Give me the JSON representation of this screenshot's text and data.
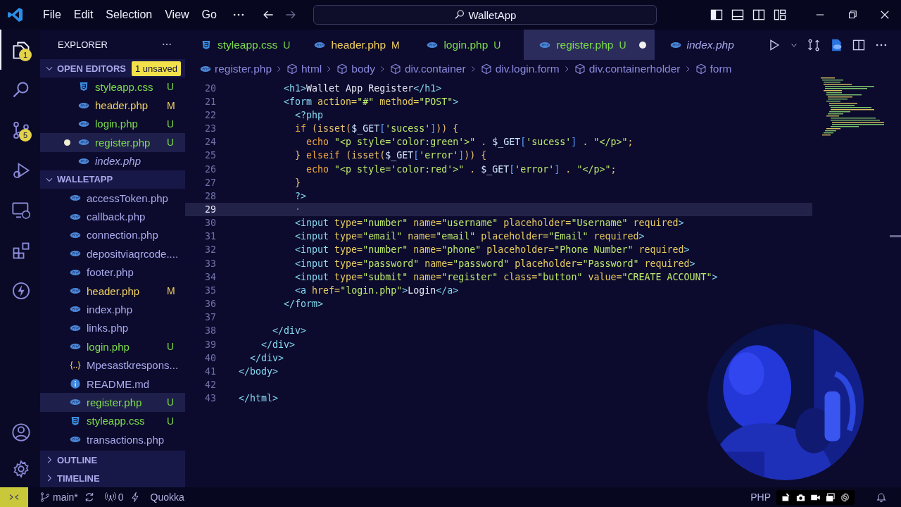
{
  "title_bar": {
    "menu": [
      "File",
      "Edit",
      "Selection",
      "View",
      "Go"
    ],
    "search": {
      "value": "WalletApp"
    }
  },
  "activity_bar": {
    "items": [
      {
        "kind": "files",
        "selected": true,
        "badge": "1"
      },
      {
        "kind": "search",
        "selected": false
      },
      {
        "kind": "source-control",
        "selected": false,
        "badge": "5"
      },
      {
        "kind": "run",
        "selected": false
      },
      {
        "kind": "remote",
        "selected": false
      },
      {
        "kind": "extensions",
        "selected": false
      },
      {
        "kind": "bolt",
        "selected": false
      }
    ],
    "bottom": [
      {
        "kind": "account"
      },
      {
        "kind": "settings"
      }
    ]
  },
  "explorer": {
    "title": "EXPLORER",
    "open_editors": {
      "label": "OPEN EDITORS",
      "expanded": true,
      "badge": "1 unsaved",
      "items": [
        {
          "name": "styleapp.css",
          "kind": "css",
          "status": "U",
          "selected": false,
          "unsaved": false,
          "preview": false
        },
        {
          "name": "header.php",
          "kind": "php",
          "status": "M",
          "selected": false,
          "unsaved": false,
          "preview": false
        },
        {
          "name": "login.php",
          "kind": "php",
          "status": "U",
          "selected": false,
          "unsaved": false,
          "preview": false
        },
        {
          "name": "register.php",
          "kind": "php",
          "status": "U",
          "selected": true,
          "unsaved": true,
          "preview": false
        },
        {
          "name": "index.php",
          "kind": "php",
          "selected": false,
          "unsaved": false,
          "preview": true
        }
      ]
    },
    "folder": {
      "label": "WALLETAPP",
      "expanded": true,
      "items": [
        {
          "name": "accessToken.php",
          "kind": "php",
          "selected": false
        },
        {
          "name": "callback.php",
          "kind": "php",
          "selected": false
        },
        {
          "name": "connection.php",
          "kind": "php",
          "selected": false
        },
        {
          "name": "depositviaqrcode....",
          "kind": "php",
          "selected": false
        },
        {
          "name": "footer.php",
          "kind": "php",
          "selected": false
        },
        {
          "name": "header.php",
          "kind": "php",
          "status": "M",
          "selected": false
        },
        {
          "name": "index.php",
          "kind": "php",
          "selected": false
        },
        {
          "name": "links.php",
          "kind": "php",
          "selected": false
        },
        {
          "name": "login.php",
          "kind": "php",
          "status": "U",
          "selected": false
        },
        {
          "name": "Mpesastkrespons...",
          "kind": "json",
          "selected": false
        },
        {
          "name": "README.md",
          "kind": "info",
          "selected": false
        },
        {
          "name": "register.php",
          "kind": "php",
          "status": "U",
          "selected": true
        },
        {
          "name": "styleapp.css",
          "kind": "css",
          "status": "U",
          "selected": false
        },
        {
          "name": "transactions.php",
          "kind": "php",
          "selected": false
        }
      ]
    },
    "sections": [
      {
        "label": "OUTLINE",
        "expanded": false
      },
      {
        "label": "TIMELINE",
        "expanded": false
      }
    ]
  },
  "tabs": [
    {
      "label": "styleapp.css",
      "kind": "css",
      "status": "U",
      "selected": false,
      "dirty": false,
      "preview": false
    },
    {
      "label": "header.php",
      "kind": "php",
      "status": "M",
      "selected": false,
      "dirty": false,
      "preview": false
    },
    {
      "label": "login.php",
      "kind": "php",
      "status": "U",
      "selected": false,
      "dirty": false,
      "preview": false
    },
    {
      "label": "register.php",
      "kind": "php",
      "status": "U",
      "selected": true,
      "dirty": true,
      "preview": false
    },
    {
      "label": "index.php",
      "kind": "php",
      "selected": false,
      "dirty": false,
      "preview": true
    }
  ],
  "breadcrumbs": [
    {
      "label": "register.php",
      "kind": "php"
    },
    {
      "label": "html",
      "kind": "element"
    },
    {
      "label": "body",
      "kind": "element"
    },
    {
      "label": "div.container",
      "kind": "element"
    },
    {
      "label": "div.login.form",
      "kind": "element"
    },
    {
      "label": "div.containerholder",
      "kind": "element"
    },
    {
      "label": "form",
      "kind": "element"
    }
  ],
  "editor": {
    "lines": [
      {
        "number": "20",
        "current": false,
        "tokens": [
          {
            "kind": "tag",
            "text": "        <h1>"
          },
          {
            "kind": "text",
            "text": "Wallet App Register"
          },
          {
            "kind": "tag",
            "text": "</h1>"
          }
        ]
      },
      {
        "number": "21",
        "current": false,
        "tokens": [
          {
            "kind": "tag",
            "text": "        <form"
          },
          {
            "kind": "attr",
            "text": " action="
          },
          {
            "kind": "str",
            "text": "\"#\""
          },
          {
            "kind": "attr",
            "text": " method="
          },
          {
            "kind": "str",
            "text": "\"POST\""
          },
          {
            "kind": "tag",
            "text": ">"
          }
        ]
      },
      {
        "number": "22",
        "current": false,
        "tokens": [
          {
            "kind": "tag",
            "text": "          <?php"
          }
        ]
      },
      {
        "number": "23",
        "current": false,
        "tokens": [
          {
            "kind": "kw",
            "text": "          if"
          },
          {
            "kind": "plain",
            "text": " (isset("
          },
          {
            "kind": "var",
            "text": "$_GET"
          },
          {
            "kind": "punct",
            "text": "["
          },
          {
            "kind": "str",
            "text": "'sucess'"
          },
          {
            "kind": "punct",
            "text": "]"
          },
          {
            "kind": "plain",
            "text": ")) {"
          }
        ]
      },
      {
        "number": "24",
        "current": false,
        "tokens": [
          {
            "kind": "kw",
            "text": "            echo "
          },
          {
            "kind": "str",
            "text": "\"<p style='color:green'>\""
          },
          {
            "kind": "plain",
            "text": " . "
          },
          {
            "kind": "var",
            "text": "$_GET"
          },
          {
            "kind": "punct",
            "text": "["
          },
          {
            "kind": "str",
            "text": "'sucess'"
          },
          {
            "kind": "punct",
            "text": "]"
          },
          {
            "kind": "plain",
            "text": " . "
          },
          {
            "kind": "str",
            "text": "\"</p>\""
          },
          {
            "kind": "plain",
            "text": ";"
          }
        ]
      },
      {
        "number": "25",
        "current": false,
        "tokens": [
          {
            "kind": "plain",
            "text": "          } "
          },
          {
            "kind": "kw",
            "text": "elseif"
          },
          {
            "kind": "plain",
            "text": " (isset("
          },
          {
            "kind": "var",
            "text": "$_GET"
          },
          {
            "kind": "punct",
            "text": "["
          },
          {
            "kind": "str",
            "text": "'error'"
          },
          {
            "kind": "punct",
            "text": "]"
          },
          {
            "kind": "plain",
            "text": ")) {"
          }
        ]
      },
      {
        "number": "26",
        "current": false,
        "tokens": [
          {
            "kind": "kw",
            "text": "            echo "
          },
          {
            "kind": "str",
            "text": "\"<p style='color:red'>\""
          },
          {
            "kind": "plain",
            "text": " . "
          },
          {
            "kind": "var",
            "text": "$_GET"
          },
          {
            "kind": "punct",
            "text": "["
          },
          {
            "kind": "str",
            "text": "'error'"
          },
          {
            "kind": "punct",
            "text": "]"
          },
          {
            "kind": "plain",
            "text": " . "
          },
          {
            "kind": "str",
            "text": "\"</p>\""
          },
          {
            "kind": "plain",
            "text": ";"
          }
        ]
      },
      {
        "number": "27",
        "current": false,
        "tokens": [
          {
            "kind": "plain",
            "text": "          }"
          }
        ]
      },
      {
        "number": "28",
        "current": false,
        "tokens": [
          {
            "kind": "tag",
            "text": "          ?>"
          }
        ]
      },
      {
        "number": "29",
        "current": true,
        "tokens": [
          {
            "kind": "ws",
            "text": "          ·"
          }
        ]
      },
      {
        "number": "30",
        "current": false,
        "tokens": [
          {
            "kind": "tag",
            "text": "          <input"
          },
          {
            "kind": "attr",
            "text": " type="
          },
          {
            "kind": "str",
            "text": "\"number\""
          },
          {
            "kind": "attr",
            "text": " name="
          },
          {
            "kind": "str",
            "text": "\"username\""
          },
          {
            "kind": "attr",
            "text": " placeholder="
          },
          {
            "kind": "str",
            "text": "\"Username\""
          },
          {
            "kind": "attr",
            "text": " required"
          },
          {
            "kind": "tag",
            "text": ">"
          }
        ]
      },
      {
        "number": "31",
        "current": false,
        "tokens": [
          {
            "kind": "tag",
            "text": "          <input"
          },
          {
            "kind": "attr",
            "text": " type="
          },
          {
            "kind": "str",
            "text": "\"email\""
          },
          {
            "kind": "attr",
            "text": " name="
          },
          {
            "kind": "str",
            "text": "\"email\""
          },
          {
            "kind": "attr",
            "text": " placeholder="
          },
          {
            "kind": "str",
            "text": "\"Email\""
          },
          {
            "kind": "attr",
            "text": " required"
          },
          {
            "kind": "tag",
            "text": ">"
          }
        ]
      },
      {
        "number": "32",
        "current": false,
        "tokens": [
          {
            "kind": "tag",
            "text": "          <input"
          },
          {
            "kind": "attr",
            "text": " type="
          },
          {
            "kind": "str",
            "text": "\"number\""
          },
          {
            "kind": "attr",
            "text": " name="
          },
          {
            "kind": "str",
            "text": "\"phone\""
          },
          {
            "kind": "attr",
            "text": " placeholder="
          },
          {
            "kind": "str",
            "text": "\"Phone Number\""
          },
          {
            "kind": "attr",
            "text": " required"
          },
          {
            "kind": "tag",
            "text": ">"
          }
        ]
      },
      {
        "number": "33",
        "current": false,
        "tokens": [
          {
            "kind": "tag",
            "text": "          <input"
          },
          {
            "kind": "attr",
            "text": " type="
          },
          {
            "kind": "str",
            "text": "\"password\""
          },
          {
            "kind": "attr",
            "text": " name="
          },
          {
            "kind": "str",
            "text": "\"password\""
          },
          {
            "kind": "attr",
            "text": " placeholder="
          },
          {
            "kind": "str",
            "text": "\"Password\""
          },
          {
            "kind": "attr",
            "text": " required"
          },
          {
            "kind": "tag",
            "text": ">"
          }
        ]
      },
      {
        "number": "34",
        "current": false,
        "tokens": [
          {
            "kind": "tag",
            "text": "          <input"
          },
          {
            "kind": "attr",
            "text": " type="
          },
          {
            "kind": "str",
            "text": "\"submit\""
          },
          {
            "kind": "attr",
            "text": " name="
          },
          {
            "kind": "str",
            "text": "\"register\""
          },
          {
            "kind": "attr",
            "text": " class="
          },
          {
            "kind": "str",
            "text": "\"button\""
          },
          {
            "kind": "attr",
            "text": " value="
          },
          {
            "kind": "str",
            "text": "\"CREATE ACCOUNT\""
          },
          {
            "kind": "tag",
            "text": ">"
          }
        ]
      },
      {
        "number": "35",
        "current": false,
        "tokens": [
          {
            "kind": "tag",
            "text": "          <a"
          },
          {
            "kind": "attr",
            "text": " href="
          },
          {
            "kind": "str",
            "text": "\"login.php\""
          },
          {
            "kind": "tag",
            "text": ">"
          },
          {
            "kind": "text",
            "text": "Login"
          },
          {
            "kind": "tag",
            "text": "</a>"
          }
        ]
      },
      {
        "number": "36",
        "current": false,
        "tokens": [
          {
            "kind": "tag",
            "text": "        </form>"
          }
        ]
      },
      {
        "number": "37",
        "current": false
      },
      {
        "number": "38",
        "current": false,
        "tokens": [
          {
            "kind": "tag",
            "text": "      </div>"
          }
        ]
      },
      {
        "number": "39",
        "current": false,
        "tokens": [
          {
            "kind": "tag",
            "text": "    </div>"
          }
        ]
      },
      {
        "number": "40",
        "current": false,
        "tokens": [
          {
            "kind": "tag",
            "text": "  </div>"
          }
        ]
      },
      {
        "number": "41",
        "current": false,
        "tokens": [
          {
            "kind": "tag",
            "text": "</body>"
          }
        ]
      },
      {
        "number": "42",
        "current": false
      },
      {
        "number": "43",
        "current": false,
        "tokens": [
          {
            "kind": "tag",
            "text": "</html>"
          }
        ]
      }
    ]
  },
  "status_bar": {
    "branch": "main*",
    "ports": "0",
    "extension": "Quokka",
    "language": "PHP"
  }
}
